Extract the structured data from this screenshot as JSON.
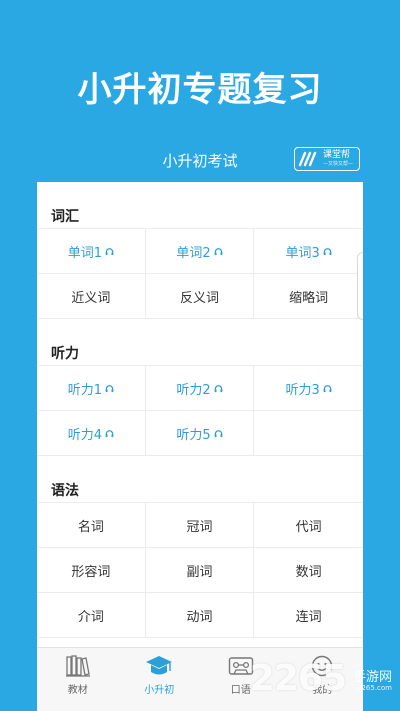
{
  "hero_title": "小升初专题复习",
  "header": {
    "title": "小升初考试",
    "logo_name": "课堂帮",
    "logo_sub": "—又快又帮—"
  },
  "sections": [
    {
      "title": "词汇",
      "cells": [
        {
          "label": "单词1",
          "audio": true
        },
        {
          "label": "单词2",
          "audio": true
        },
        {
          "label": "单词3",
          "audio": true
        },
        {
          "label": "近义词",
          "audio": false
        },
        {
          "label": "反义词",
          "audio": false
        },
        {
          "label": "缩略词",
          "audio": false
        }
      ]
    },
    {
      "title": "听力",
      "cells": [
        {
          "label": "听力1",
          "audio": true
        },
        {
          "label": "听力2",
          "audio": true
        },
        {
          "label": "听力3",
          "audio": true
        },
        {
          "label": "听力4",
          "audio": true
        },
        {
          "label": "听力5",
          "audio": true
        }
      ]
    },
    {
      "title": "语法",
      "cells": [
        {
          "label": "名词",
          "audio": false
        },
        {
          "label": "冠词",
          "audio": false
        },
        {
          "label": "代词",
          "audio": false
        },
        {
          "label": "形容词",
          "audio": false
        },
        {
          "label": "副词",
          "audio": false
        },
        {
          "label": "数词",
          "audio": false
        },
        {
          "label": "介词",
          "audio": false
        },
        {
          "label": "动词",
          "audio": false
        },
        {
          "label": "连词",
          "audio": false
        }
      ]
    }
  ],
  "tabs": [
    {
      "label": "教材",
      "icon": "books-icon",
      "active": false
    },
    {
      "label": "小升初",
      "icon": "graduation-cap-icon",
      "active": true
    },
    {
      "label": "口语",
      "icon": "cassette-icon",
      "active": false
    },
    {
      "label": "我的",
      "icon": "smiley-icon",
      "active": false
    }
  ],
  "watermark": {
    "number": "2265",
    "text": "手游网",
    "url": "2265.com"
  },
  "colors": {
    "background": "#29a8e3",
    "accent": "#2a9fd8",
    "text": "#333333"
  }
}
